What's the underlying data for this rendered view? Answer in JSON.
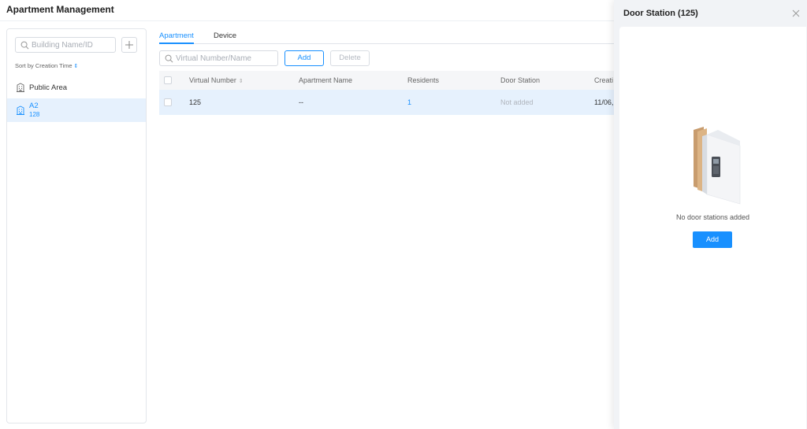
{
  "header": {
    "title": "Apartment Management"
  },
  "sidebar": {
    "search_placeholder": "Building Name/ID",
    "sort_label": "Sort by Creation Time",
    "items": [
      {
        "label": "Public Area",
        "icon": "building-icon"
      },
      {
        "label": "A2",
        "sub": "128",
        "icon": "building-icon",
        "selected": true
      }
    ]
  },
  "tabs": [
    "Apartment",
    "Device"
  ],
  "toolbar": {
    "search_placeholder": "Virtual Number/Name",
    "add_label": "Add",
    "delete_label": "Delete"
  },
  "table": {
    "columns": [
      "Virtual Number",
      "Apartment Name",
      "Residents",
      "Door Station",
      "Creati"
    ],
    "rows": [
      {
        "virtual_number": "125",
        "apartment_name": "--",
        "residents": "1",
        "door_station": "Not added",
        "creation": "11/06,"
      }
    ]
  },
  "drawer": {
    "title": "Door Station (125)",
    "empty_text": "No door stations added",
    "add_label": "Add"
  },
  "colors": {
    "accent": "#1890ff",
    "selected_bg": "#e6f1fd",
    "muted": "#b0b5bd"
  }
}
